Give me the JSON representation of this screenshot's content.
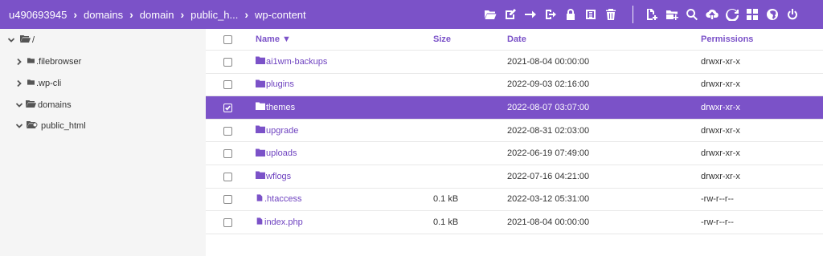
{
  "breadcrumb": [
    "u490693945",
    "domains",
    "domain",
    "public_h...",
    "wp-content"
  ],
  "toolbar": {
    "icons": [
      "folder-open-icon",
      "edit-icon",
      "move-arrow-icon",
      "move-out-icon",
      "lock-icon",
      "archive-icon",
      "trash-icon",
      "new-file-icon",
      "new-folder-icon",
      "search-icon",
      "upload-icon",
      "refresh-icon",
      "grid-view-icon",
      "globe-icon",
      "power-icon"
    ]
  },
  "sidebar": {
    "items": [
      {
        "label": "/",
        "expanded": true
      },
      {
        "label": ".filebrowser",
        "expanded": false
      },
      {
        "label": ".wp-cli",
        "expanded": false
      },
      {
        "label": "domains",
        "expanded": true
      },
      {
        "label": "public_html",
        "expanded": true
      }
    ]
  },
  "table": {
    "headers": {
      "name": "Name ▼",
      "size": "Size",
      "date": "Date",
      "permissions": "Permissions"
    },
    "rows": [
      {
        "name": "ai1wm-backups",
        "type": "folder",
        "size": "",
        "date": "2021-08-04 00:00:00",
        "perm": "drwxr-xr-x",
        "selected": false
      },
      {
        "name": "plugins",
        "type": "folder",
        "size": "",
        "date": "2022-09-03 02:16:00",
        "perm": "drwxr-xr-x",
        "selected": false
      },
      {
        "name": "themes",
        "type": "folder",
        "size": "",
        "date": "2022-08-07 03:07:00",
        "perm": "drwxr-xr-x",
        "selected": true
      },
      {
        "name": "upgrade",
        "type": "folder",
        "size": "",
        "date": "2022-08-31 02:03:00",
        "perm": "drwxr-xr-x",
        "selected": false
      },
      {
        "name": "uploads",
        "type": "folder",
        "size": "",
        "date": "2022-06-19 07:49:00",
        "perm": "drwxr-xr-x",
        "selected": false
      },
      {
        "name": "wflogs",
        "type": "folder",
        "size": "",
        "date": "2022-07-16 04:21:00",
        "perm": "drwxr-xr-x",
        "selected": false
      },
      {
        "name": ".htaccess",
        "type": "file",
        "size": "0.1 kB",
        "date": "2022-03-12 05:31:00",
        "perm": "-rw-r--r--",
        "selected": false
      },
      {
        "name": "index.php",
        "type": "file",
        "size": "0.1 kB",
        "date": "2021-08-04 00:00:00",
        "perm": "-rw-r--r--",
        "selected": false
      }
    ]
  },
  "colors": {
    "accent": "#7b52c8",
    "sidebar_bg": "#f5f5f5",
    "link": "#6f43c0"
  }
}
